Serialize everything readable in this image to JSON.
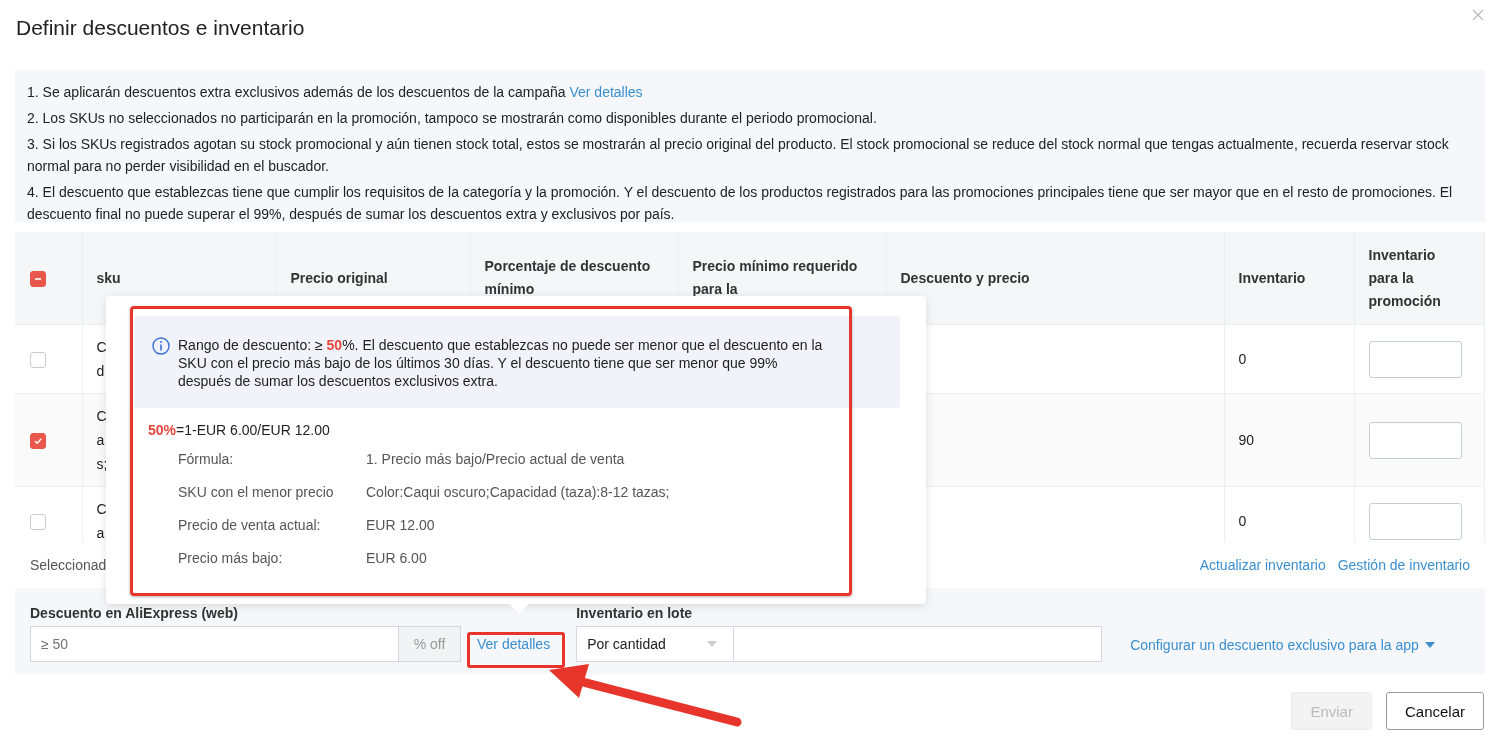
{
  "dialog": {
    "title": "Definir descuentos e inventario"
  },
  "notes": [
    {
      "text": "1. Se aplicarán descuentos extra exclusivos además de los descuentos de la campaña",
      "link": "Ver detalles"
    },
    {
      "text": "2. Los SKUs no seleccionados no participarán en la promoción, tampoco se mostrarán como disponibles durante el periodo promocional."
    },
    {
      "text": "3. Si los SKUs registrados agotan su stock promocional y aún tienen stock total, estos se mostrarán al precio original del producto. El stock promocional se reduce del stock normal que tengas actualmente, recuerda reservar stock normal para no perder visibilidad en el buscador."
    },
    {
      "text": "4. El descuento que establezcas tiene que cumplir los requisitos de la categoría y la promoción. Y el descuento de los productos registrados para las promociones principales tiene que ser mayor que en el resto de promociones. El descuento final no puede superar el 99%, después de sumar los descuentos extra y exclusivos por país."
    }
  ],
  "table": {
    "select_all": {
      "indeterminate": true
    },
    "columns": [
      "sku",
      "Precio original",
      "Porcentaje de descuento mínimo",
      "Precio mínimo requerido para la",
      "Descuento y precio",
      "Inventario",
      "Inventario para la promoción"
    ],
    "rows": [
      {
        "checked": false,
        "sku": [
          "C",
          "d"
        ],
        "inventory": "0"
      },
      {
        "checked": true,
        "sku": [
          "C",
          "a",
          "s;"
        ],
        "inventory": "90"
      },
      {
        "checked": false,
        "sku": [
          "C",
          "a"
        ],
        "inventory": "0"
      }
    ]
  },
  "selection": {
    "text": "Seleccionad",
    "links": [
      "Actualizar inventario",
      "Gestión de inventario"
    ]
  },
  "bulk": {
    "discount_label": "Descuento en AliExpress (web)",
    "discount_placeholder": "≥ 50",
    "unit": "% off",
    "details_link": "Ver detalles",
    "inventory_label": "Inventario en lote",
    "inventory_mode": "Por cantidad",
    "app_link": "Configurar un descuento exclusivo para la app"
  },
  "popover": {
    "info_before": "Rango de descuento: ≥ ",
    "info_highlight": "50",
    "info_after": "%. El descuento que establezcas no puede ser menor que el descuento en la SKU con el precio más bajo de los últimos 30 días. Y el descuento tiene que ser menor que 99% después de sumar los descuentos exclusivos extra.",
    "formula_highlight": "50%",
    "formula_rest": "=1-EUR 6.00/EUR 12.00",
    "details": [
      {
        "label": "Fórmula:",
        "value": "1. Precio más bajo/Precio actual de venta"
      },
      {
        "label": "SKU con el menor precio",
        "value": "Color:Caqui oscuro;Capacidad (taza):8-12 tazas;"
      },
      {
        "label": "Precio de venta actual:",
        "value": "EUR 12.00"
      },
      {
        "label": "Precio más bajo:",
        "value": "EUR 6.00"
      }
    ]
  },
  "buttons": [
    {
      "label": "Enviar",
      "disabled": true
    },
    {
      "label": "Cancelar",
      "disabled": false
    }
  ]
}
